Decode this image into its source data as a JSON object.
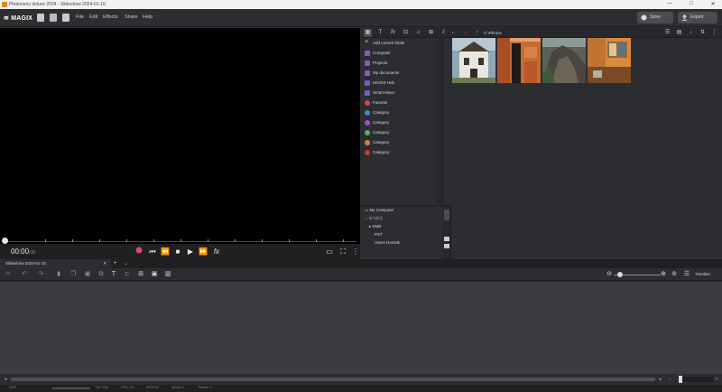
{
  "window": {
    "title": "Photostory deluxe 2024 - Slideshow 2024-01-10",
    "controls": [
      "—",
      "□",
      "✕"
    ]
  },
  "menubar": {
    "logo": "MAGIX",
    "menus": [
      "File",
      "Edit",
      "Effects",
      "Share",
      "Help"
    ],
    "store_label": "Store",
    "export_label": "Export"
  },
  "preview": {
    "timecode": "00:00",
    "timecode_frames": "00"
  },
  "media_pool": {
    "path": "C:\\Photos",
    "tree": [
      {
        "label": "Add current folder",
        "icon": "plus-icon",
        "color": "#d7d9dc"
      },
      {
        "label": "Computer",
        "icon": "computer-icon",
        "color": "#8e55c9"
      },
      {
        "label": "Projects",
        "icon": "projects-icon",
        "color": "#8e55c9"
      },
      {
        "label": "My documents",
        "icon": "documents-icon",
        "color": "#8e55c9"
      },
      {
        "label": "MAGIX Hub",
        "icon": "hub-icon",
        "color": "#6a5fc9"
      },
      {
        "label": "Smart Mixer",
        "icon": "smart-mixer-icon",
        "color": "#6a5fc9"
      },
      {
        "label": "Favorite",
        "icon": "heart-icon",
        "color": "#d0445a"
      },
      {
        "label": "Category",
        "icon": "category-icon",
        "color": "#3a86d9"
      },
      {
        "label": "Category",
        "icon": "category-icon",
        "color": "#a052c9"
      },
      {
        "label": "Category",
        "icon": "category-icon",
        "color": "#4fb45a"
      },
      {
        "label": "Category",
        "icon": "category-icon",
        "color": "#c8892a"
      },
      {
        "label": "Category",
        "icon": "category-icon",
        "color": "#c03a4a"
      }
    ],
    "drives": {
      "root": "My Computer",
      "items": [
        {
          "label": "C:\\ (C:)",
          "level": 0
        },
        {
          "label": "SMB",
          "level": 1
        },
        {
          "label": "PST",
          "level": 1
        },
        {
          "label": "Users Home$",
          "level": 1
        }
      ]
    },
    "thumbnails": [
      {
        "name": "white-house-photo"
      },
      {
        "name": "orange-building-photo"
      },
      {
        "name": "rock-cliff-photo"
      },
      {
        "name": "orange-wall-photo"
      }
    ]
  },
  "storyboard": {
    "tab_label": "Slideshow 2024-01-10",
    "timeline_label": "Timeline"
  },
  "status": {
    "items": [
      "1920",
      "HD 720p",
      "CPU: 0%",
      "00:00:00",
      "Media: 0",
      "Photos: 0"
    ]
  }
}
